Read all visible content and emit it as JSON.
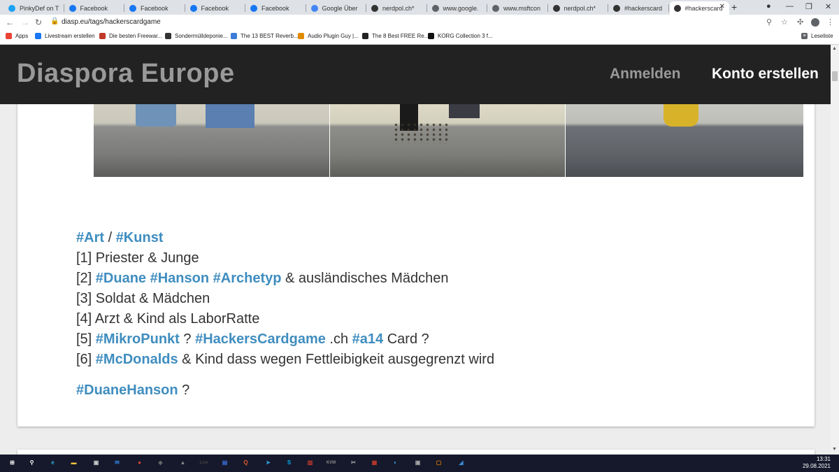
{
  "browser": {
    "tabs": [
      {
        "label": "PinkyDef on T",
        "icon": "twitter-icon",
        "color": "#1da1f2"
      },
      {
        "label": "Facebook",
        "icon": "facebook-icon",
        "color": "#1877f2"
      },
      {
        "label": "Facebook",
        "icon": "facebook-icon",
        "color": "#1877f2"
      },
      {
        "label": "Facebook",
        "icon": "facebook-icon",
        "color": "#1877f2"
      },
      {
        "label": "Facebook",
        "icon": "facebook-icon",
        "color": "#1877f2"
      },
      {
        "label": "Google Über",
        "icon": "google-translate-icon",
        "color": "#4285f4"
      },
      {
        "label": "nerdpol.ch*",
        "icon": "diaspora-icon",
        "color": "#333333"
      },
      {
        "label": "www.google.",
        "icon": "globe-icon",
        "color": "#5f6368"
      },
      {
        "label": "www.msftcon",
        "icon": "globe-icon",
        "color": "#5f6368"
      },
      {
        "label": "nerdpol.ch*",
        "icon": "diaspora-icon",
        "color": "#333333"
      },
      {
        "label": "#hackerscard",
        "icon": "diaspora-icon",
        "color": "#333333"
      },
      {
        "label": "#hackerscard",
        "icon": "diaspora-icon",
        "color": "#333333"
      }
    ],
    "new_tab": "+",
    "url": "diasp.eu/tags/hackerscardgame",
    "bookmarks": [
      {
        "label": "Apps",
        "icon": "apps-grid-icon",
        "color": "#ea4335"
      },
      {
        "label": "Livestream erstellen",
        "icon": "facebook-icon",
        "color": "#1877f2"
      },
      {
        "label": "Die besten Freewar...",
        "icon": "star-icon",
        "color": "#c0392b"
      },
      {
        "label": "Sondermülldeponie...",
        "icon": "wikipedia-icon",
        "color": "#333333"
      },
      {
        "label": "The 13 BEST Reverb...",
        "icon": "bookmark-icon",
        "color": "#3b7dd8"
      },
      {
        "label": "Audio Plugin Guy |...",
        "icon": "bookmark-icon",
        "color": "#e08a00"
      },
      {
        "label": "The 8 Best FREE Re...",
        "icon": "bookmark-icon",
        "color": "#222222"
      },
      {
        "label": "KORG Collection 3 f...",
        "icon": "korg-icon",
        "color": "#111111"
      }
    ],
    "reading_list": "Leseliste"
  },
  "site": {
    "brand": "Diaspora Europe",
    "nav_login": "Anmelden",
    "nav_signup": "Konto erstellen"
  },
  "post": {
    "lines": [
      [
        {
          "t": "#Art",
          "tag": true
        },
        {
          "t": " / ",
          "tag": false
        },
        {
          "t": "#Kunst",
          "tag": true
        }
      ],
      [
        {
          "t": "[1] Priester & Junge",
          "tag": false
        }
      ],
      [
        {
          "t": "[2] ",
          "tag": false
        },
        {
          "t": "#Duane",
          "tag": true
        },
        {
          "t": " ",
          "tag": false
        },
        {
          "t": "#Hanson",
          "tag": true
        },
        {
          "t": " ",
          "tag": false
        },
        {
          "t": "#Archetyp",
          "tag": true
        },
        {
          "t": " & ausländisches Mädchen",
          "tag": false
        }
      ],
      [
        {
          "t": "[3] Soldat & Mädchen",
          "tag": false
        }
      ],
      [
        {
          "t": "[4] Arzt & Kind als LaborRatte",
          "tag": false
        }
      ],
      [
        {
          "t": "[5] ",
          "tag": false
        },
        {
          "t": "#MikroPunkt",
          "tag": true
        },
        {
          "t": " ? ",
          "tag": false
        },
        {
          "t": "#HackersCardgame",
          "tag": true
        },
        {
          "t": " .ch ",
          "tag": false
        },
        {
          "t": "#a14",
          "tag": true
        },
        {
          "t": " Card ?",
          "tag": false
        }
      ],
      [
        {
          "t": "[6] ",
          "tag": false
        },
        {
          "t": "#McDonalds",
          "tag": true
        },
        {
          "t": " & Kind dass wegen Fettleibigkeit ausgegrenzt wird",
          "tag": false
        }
      ]
    ],
    "footer_line": [
      {
        "t": "#DuaneHanson",
        "tag": true
      },
      {
        "t": " ?",
        "tag": false
      }
    ]
  },
  "taskbar": {
    "time": "13:31",
    "date": "29.08.2021",
    "apps": [
      {
        "name": "windows-start-icon",
        "color": "#ffffff",
        "glyph": "⊞"
      },
      {
        "name": "search-icon",
        "color": "#ffffff",
        "glyph": "⚲"
      },
      {
        "name": "edge-icon",
        "color": "#2ea8d8",
        "glyph": "e"
      },
      {
        "name": "file-explorer-icon",
        "color": "#f2c240",
        "glyph": "▬"
      },
      {
        "name": "store-icon",
        "color": "#cccccc",
        "glyph": "▣"
      },
      {
        "name": "mail-icon",
        "color": "#2f7ed8",
        "glyph": "✉"
      },
      {
        "name": "chrome-icon",
        "color": "#db4437",
        "glyph": "●"
      },
      {
        "name": "app-icon",
        "color": "#666666",
        "glyph": "◆"
      },
      {
        "name": "app-icon",
        "color": "#888888",
        "glyph": "▲"
      },
      {
        "name": "live-icon",
        "color": "#444444",
        "glyph": "Live"
      },
      {
        "name": "app-icon",
        "color": "#3a6fd8",
        "glyph": "▤"
      },
      {
        "name": "app-icon",
        "color": "#e55b2b",
        "glyph": "Q"
      },
      {
        "name": "telegram-icon",
        "color": "#2ca5e0",
        "glyph": "➤"
      },
      {
        "name": "skype-icon",
        "color": "#00aff0",
        "glyph": "S"
      },
      {
        "name": "app-icon",
        "color": "#c0392b",
        "glyph": "▥"
      },
      {
        "name": "app-icon",
        "color": "#888888",
        "glyph": "KVM"
      },
      {
        "name": "app-icon",
        "color": "#aaaaaa",
        "glyph": "✂"
      },
      {
        "name": "app-icon",
        "color": "#c0392b",
        "glyph": "▦"
      },
      {
        "name": "app-icon",
        "color": "#3aa0d8",
        "glyph": "◐"
      },
      {
        "name": "app-icon",
        "color": "#aaaaaa",
        "glyph": "▣"
      },
      {
        "name": "app-icon",
        "color": "#e07b00",
        "glyph": "▢"
      },
      {
        "name": "app-icon",
        "color": "#3a8fd8",
        "glyph": "◢"
      }
    ]
  }
}
